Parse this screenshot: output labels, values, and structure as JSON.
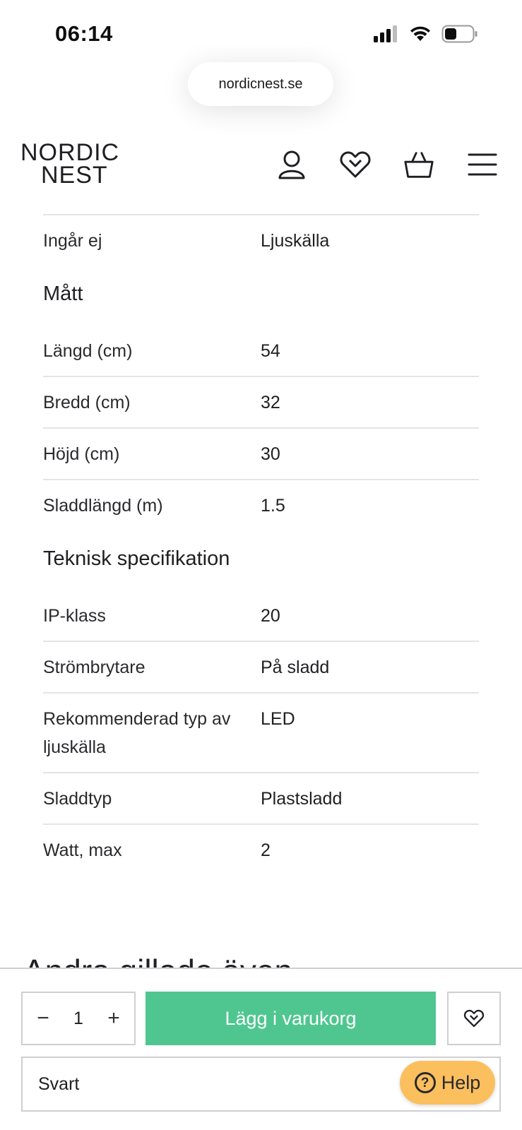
{
  "status_bar": {
    "time": "06:14"
  },
  "browser": {
    "url": "nordicnest.se"
  },
  "header": {
    "logo_line1": "NORDIC",
    "logo_line2": "NEST",
    "icons": [
      "user-icon",
      "wishlist-heart-icon",
      "basket-icon",
      "menu-icon"
    ]
  },
  "specs": {
    "top_row": {
      "label": "Ingår ej",
      "value": "Ljuskälla"
    },
    "sections": [
      {
        "title": "Mått",
        "rows": [
          {
            "label": "Längd (cm)",
            "value": "54"
          },
          {
            "label": "Bredd (cm)",
            "value": "32"
          },
          {
            "label": "Höjd (cm)",
            "value": "30"
          },
          {
            "label": "Sladdlängd (m)",
            "value": "1.5"
          }
        ]
      },
      {
        "title": "Teknisk specifikation",
        "rows": [
          {
            "label": "IP-klass",
            "value": "20"
          },
          {
            "label": "Strömbrytare",
            "value": "På sladd"
          },
          {
            "label": "Rekommenderad typ av ljuskälla",
            "value": "LED"
          },
          {
            "label": "Sladdtyp",
            "value": "Plastsladd"
          },
          {
            "label": "Watt, max",
            "value": "2"
          }
        ]
      }
    ]
  },
  "next_section": {
    "title": "Andra gillade även"
  },
  "purchase_bar": {
    "quantity": "1",
    "minus": "−",
    "plus": "+",
    "add_to_cart_label": "Lägg i varukorg",
    "variant_value": "Svart",
    "help_label": "Help",
    "help_glyph": "?"
  },
  "colors": {
    "add_to_cart_bg": "#4fc690",
    "help_bg": "#fbbf5e",
    "text": "#1f1f23",
    "divider": "#e4e4e6"
  }
}
